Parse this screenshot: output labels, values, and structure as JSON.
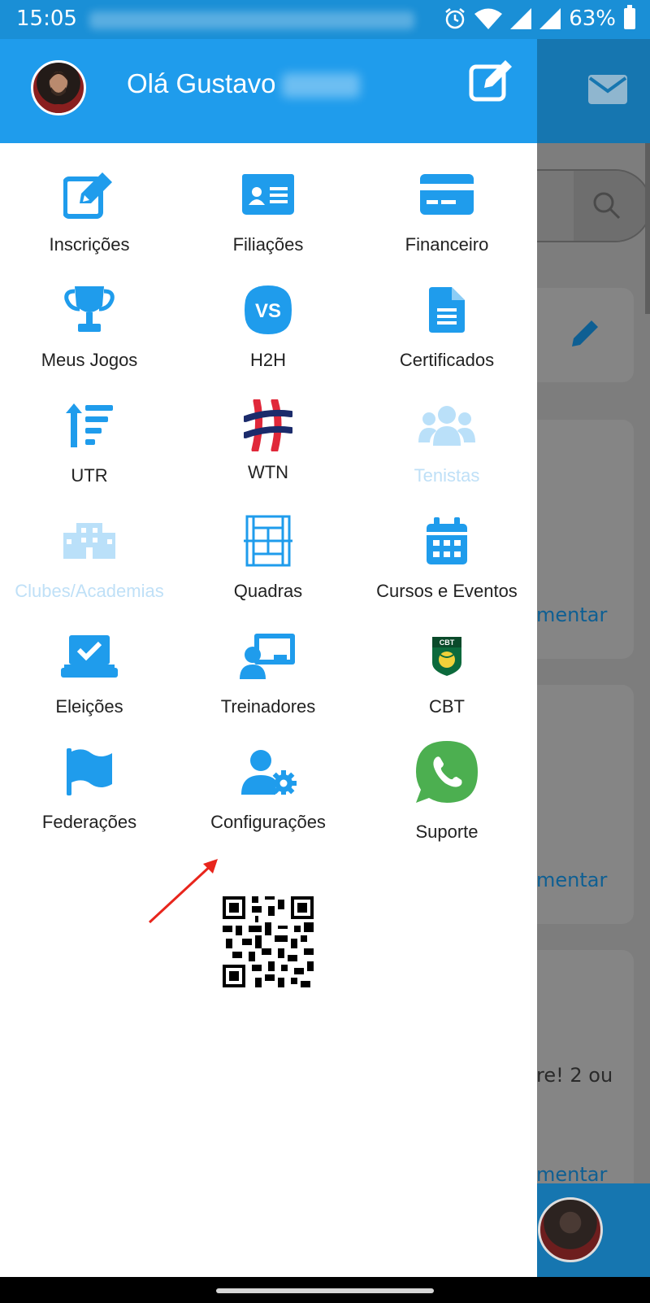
{
  "status_bar": {
    "time": "15:05",
    "battery_percent": "63%"
  },
  "drawer": {
    "greeting": "Olá Gustavo",
    "menu": [
      {
        "label": "Inscrições",
        "icon": "edit-icon",
        "enabled": true
      },
      {
        "label": "Filiações",
        "icon": "id-card-icon",
        "enabled": true
      },
      {
        "label": "Financeiro",
        "icon": "credit-card-icon",
        "enabled": true
      },
      {
        "label": "Meus Jogos",
        "icon": "trophy-icon",
        "enabled": true
      },
      {
        "label": "H2H",
        "icon": "vs-icon",
        "enabled": true
      },
      {
        "label": "Certificados",
        "icon": "document-icon",
        "enabled": true
      },
      {
        "label": "UTR",
        "icon": "sort-up-icon",
        "enabled": true
      },
      {
        "label": "WTN",
        "icon": "wtn-logo-icon",
        "enabled": true
      },
      {
        "label": "Tenistas",
        "icon": "users-icon",
        "enabled": false
      },
      {
        "label": "Clubes/Academias",
        "icon": "building-icon",
        "enabled": false
      },
      {
        "label": "Quadras",
        "icon": "tennis-court-icon",
        "enabled": true
      },
      {
        "label": "Cursos e Eventos",
        "icon": "calendar-icon",
        "enabled": true
      },
      {
        "label": "Eleições",
        "icon": "ballot-box-icon",
        "enabled": true
      },
      {
        "label": "Treinadores",
        "icon": "teacher-icon",
        "enabled": true
      },
      {
        "label": "CBT",
        "icon": "cbt-shield-icon",
        "enabled": true
      },
      {
        "label": "Federações",
        "icon": "flag-icon",
        "enabled": true
      },
      {
        "label": "Configurações",
        "icon": "user-settings-icon",
        "enabled": true
      },
      {
        "label": "Suporte",
        "icon": "whatsapp-icon",
        "enabled": true
      }
    ],
    "cbt_badge_text": "CBT",
    "vs_text": "VS"
  },
  "background": {
    "comment_link_1": "mentar",
    "comment_link_2": "mentar",
    "snippet_text": "re! 2 ou",
    "comment_link_3": "mentar"
  },
  "colors": {
    "primary": "#1f9cec",
    "status_bar": "#1a8fd6",
    "whatsapp": "#4caf50",
    "disabled": "#bfe0f7"
  }
}
